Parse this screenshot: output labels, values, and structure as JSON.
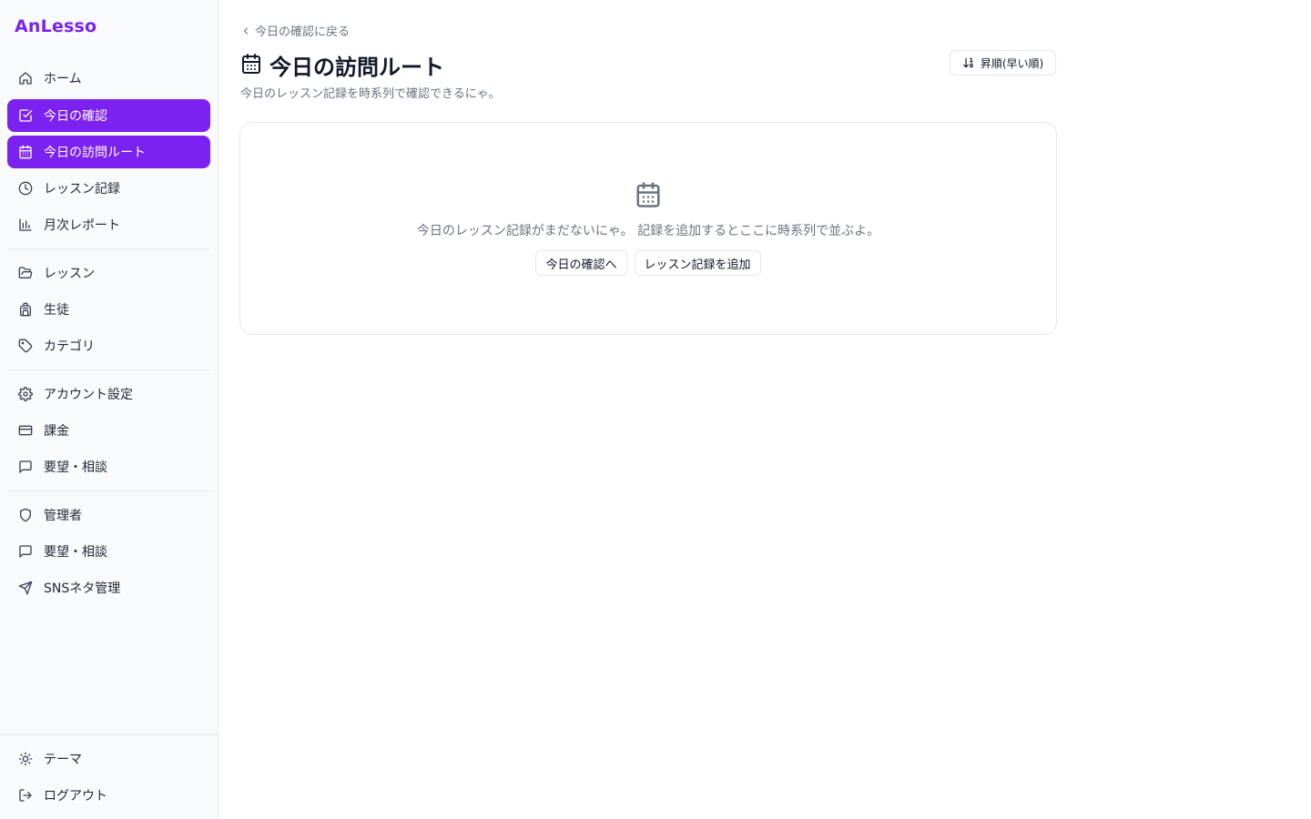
{
  "app": {
    "brand": "AnLesso"
  },
  "sidebar": {
    "items": [
      {
        "label": "ホーム",
        "icon": "home-icon"
      },
      {
        "label": "今日の確認",
        "icon": "check-square-icon",
        "active": true
      },
      {
        "label": "今日の訪問ルート",
        "icon": "calendar-icon",
        "active": true
      },
      {
        "label": "レッスン記録",
        "icon": "clock-icon"
      },
      {
        "label": "月次レポート",
        "icon": "bar-chart-icon"
      },
      {
        "label": "レッスン",
        "icon": "folder-open-icon"
      },
      {
        "label": "生徒",
        "icon": "backpack-icon"
      },
      {
        "label": "カテゴリ",
        "icon": "tag-icon"
      },
      {
        "label": "アカウント設定",
        "icon": "gear-icon"
      },
      {
        "label": "課金",
        "icon": "credit-card-icon"
      },
      {
        "label": "要望・相談",
        "icon": "message-square-icon"
      },
      {
        "label": "管理者",
        "icon": "shield-icon"
      },
      {
        "label": "要望・相談",
        "icon": "message-square-icon"
      },
      {
        "label": "SNSネタ管理",
        "icon": "send-icon"
      }
    ],
    "footer": [
      {
        "label": "テーマ",
        "icon": "sun-icon"
      },
      {
        "label": "ログアウト",
        "icon": "log-out-icon"
      }
    ]
  },
  "main": {
    "back_link": "今日の確認に戻る",
    "title": "今日の訪問ルート",
    "subtitle": "今日のレッスン記録を時系列で確認できるにゃ。",
    "sort_label": "昇順(早い順)",
    "empty": {
      "message": "今日のレッスン記録がまだないにゃ。 記録を追加するとここに時系列で並ぶよ。",
      "primary_button": "今日の確認へ",
      "secondary_button": "レッスン記録を追加"
    }
  },
  "colors": {
    "accent": "#7c22f0",
    "brand": "#7c22e8"
  }
}
